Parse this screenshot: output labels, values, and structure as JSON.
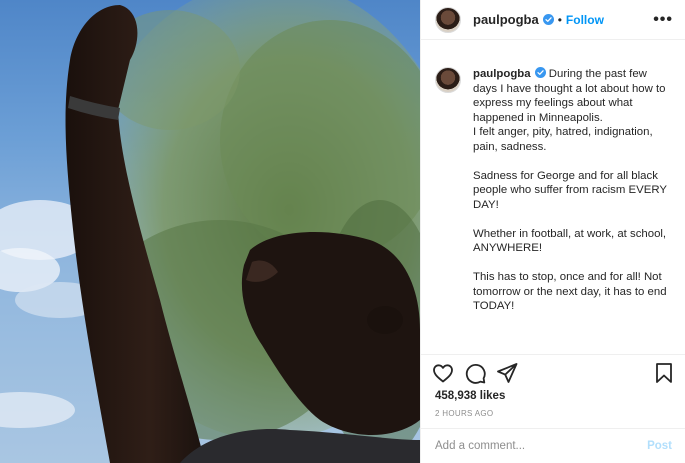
{
  "post": {
    "username": "paulpogba",
    "follow_label": "Follow",
    "separator": "•",
    "more_label": "•••",
    "caption": "During the past few days I have thought a lot about how to express my feelings about what happened in Minneapolis.\nI felt anger, pity, hatred, indignation, pain, sadness.\n\nSadness for George and for all black people who suffer from racism EVERY DAY!\n\nWhether in football, at work, at school, ANYWHERE!\n\nThis has to stop, once and for all! Not tomorrow or the next day, it has to end TODAY!",
    "likes": "458,938 likes",
    "timestamp": "2 HOURS AGO",
    "comment_placeholder": "Add a comment...",
    "post_label": "Post"
  },
  "icons": {
    "verified": "verified-badge-icon",
    "like": "heart-icon",
    "comment": "speech-bubble-icon",
    "share": "paper-plane-icon",
    "save": "bookmark-icon",
    "more": "more-options-icon"
  },
  "colors": {
    "link_blue": "#0095f6",
    "post_disabled": "#b2dffc",
    "muted": "#8e8e8e",
    "text": "#262626"
  }
}
